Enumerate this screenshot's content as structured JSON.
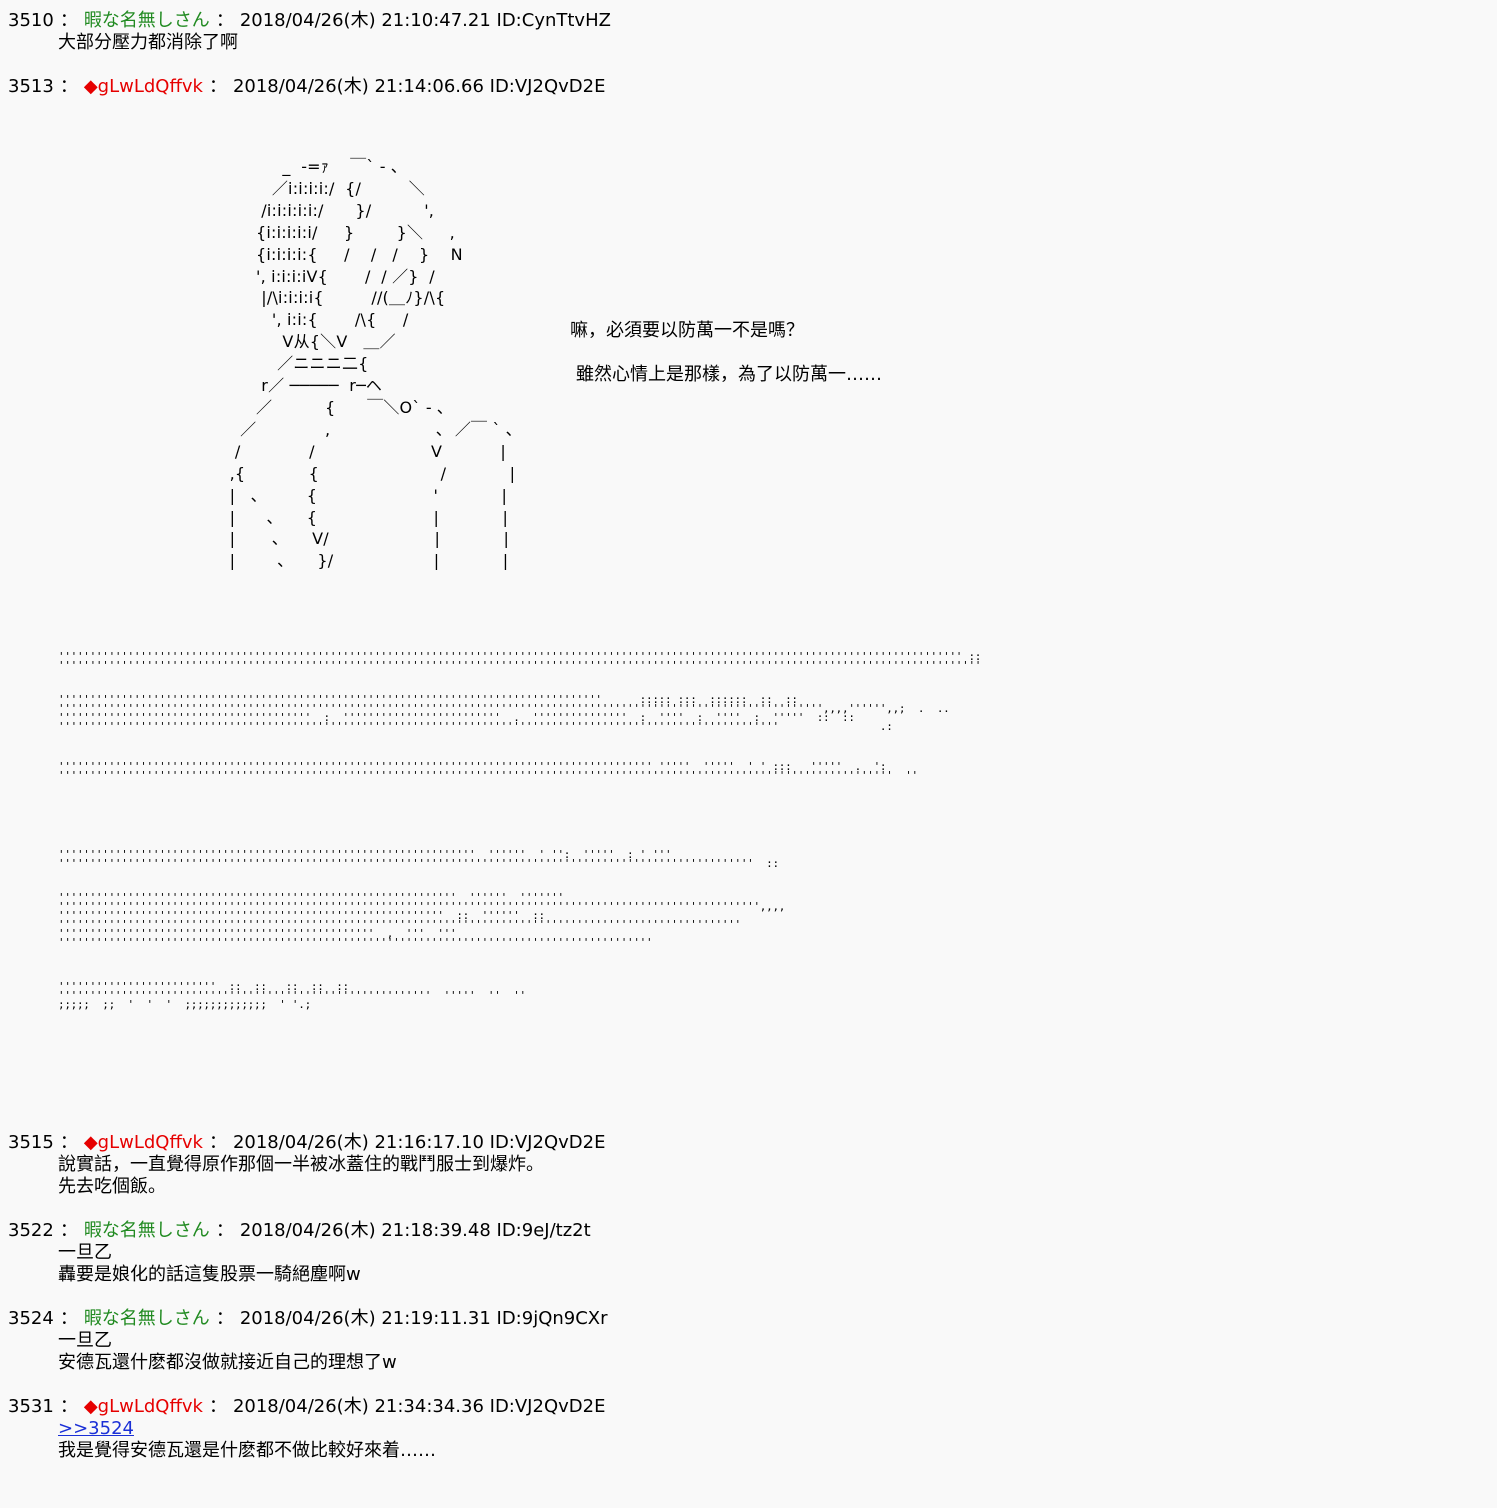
{
  "posts": [
    {
      "num": "3510",
      "name": "暇な名無しさん",
      "date": "2018/04/26(木) 21:10:47.21 ID:CynTtvHZ",
      "lines": [
        "大部分壓力都消除了啊"
      ]
    },
    {
      "num": "3513",
      "name": "◆gLwLdQffvk",
      "date": "2018/04/26(木) 21:14:06.66 ID:VJ2QvD2E"
    },
    {
      "num": "3515",
      "name": "◆gLwLdQffvk",
      "date": "2018/04/26(木) 21:16:17.10 ID:VJ2QvD2E",
      "lines": [
        "說實話，一直覺得原作那個一半被冰蓋住的戰鬥服士到爆炸。",
        "先去吃個飯。"
      ]
    },
    {
      "num": "3522",
      "name": "暇な名無しさん",
      "date": "2018/04/26(木) 21:18:39.48 ID:9eJ/tz2t",
      "lines": [
        "一旦乙",
        "轟要是娘化的話這隻股票一騎絕塵啊w"
      ]
    },
    {
      "num": "3524",
      "name": "暇な名無しさん",
      "date": "2018/04/26(木) 21:19:11.31 ID:9jQn9CXr",
      "lines": [
        "一旦乙",
        "安德瓦還什麽都沒做就接近自己的理想了w"
      ]
    },
    {
      "num": "3531",
      "name": "◆gLwLdQffvk",
      "date": "2018/04/26(木) 21:34:34.36 ID:VJ2QvD2E",
      "anchor": ">>3524",
      "lines": [
        "我是覺得安德瓦還是什麽都不做比較好來着……"
      ]
    }
  ],
  "art": {
    "text": "            _  -=ｧ    ￣` ‐ ､\n          ／i:i:i:i:/  {/         ＼\n        /i:i:i:i:i:/      }/          ',\n       {i:i:i:i:i/     }        }＼     ,\n       {i:i:i:i:{     /    /   /    }    N\n       ', i:i:i:iV{       /  / ／}  /\n        |/\\i:i:i:i{         //(＿ﾉ}/\\{\n          ', i:i:{       /\\{     /\n            V从{＼V   ＿／\n           ／ニニニ二{\n        r／ ─────  r─ヘ\n       ／          {      ￣＼O` ‐ ､\n    ／             ,                    ､  ／￣ ` ､\n   /             /                      V           |\n  ,{            {                       /            |\n  |   ､         {                      '            |\n  |      ､      {                      |            |\n  |       ､      V/                    |            |\n  |        ､      }/                   |            |",
    "dots1": "''''''''''''''''''''''''''''''''''''''''''''''''''''''''''''''''''''''''''''''''''''''''''''''''''''''''''''''''''''''''''''''''''''''''''''''' ::\n''''''''''''''''''''''''''''''''''''''''''''''''''''''''''''''''''''''''''''''''''''''''''''''''''''''''''''''''''''''''''''''''''''''''''''''''''",
    "dots2": "''''''''''''''''''''''''''''''''''''''''''''''''''''''''''''''''''''''''''''''''''''''      ::::: :::  ::::::  ::  ::\n''''''''''''''''''''''''''''''''''''''''''''''''''''''''''''''''''''''''''''''''''''''''''''''''''''''''''''''''''''''''',,,,'''''',,;  .  ..\n''''''''''''''''''''''''''''''''''''''''  :  '''''''''''''''''''''''''  .  '''''''''''''''  :  ''''  :  ''''  :  '''''  ::  ::\n''''''''''''''''''''''''''''''''''''''''''''''''''''''''''''''''''''''''''''''''''''''''''''''''''''''''''''''''''                .:",
    "dots3": "'''''''''''''''''''''''''''''''''''''''''''''''''''''''''''''''''''''''''''''''''''''''''''''' '''''  '''''  ' ' :::   '''''  .  ':\n''''''''''''''''''''''''''''''''''''''''''''''''''''''''''''''''''''''''''''''''''''''''''''''''''''''''''''''''''''''''''''''''''''  ''",
    "dots4": "''''''''''''''''''''''''''''''''''''''''''''''''''''''''''''''''''  ''''''  ' '':  '''''  : ' '''\n''''''''''''''''''''''''''''''''''''''''''''''''''''''''''''''''''''''''''''''''''''''''''''''''''''''''''''''  ::",
    "dots5": "'''''''''''''''''''''''''''''''''''''''''''''''''''''''''''''''  ''''''  '''''''\n''''''''''''''''''''''''''''''''''''''''''''''''''''''''''''''''''''''''''''''''''''''''''''''''''''''''''''''',,,,\n'''''''''''''''''''''''''''''''''''''''''''''''''''''''''''''  ::  ''''''  ::\n''''''''''''''''''''''''''''''''''''''''''''''''''''''''''''''''''''''''''''''''''''''''''''''''''''''''''''\n''''''''''''''''''''''''''''''''''''''''''''''''''  ,  '''  '''\n''''''''''''''''''''''''''''''''''''''''''''''''''''''''''''''''''''''''''''''''''''''''''''''",
    "dots6": "'''''''''''''''''''''''''  ::  ::   ::  ::  ::\n'''''''''''''''''''''''''''''''''''''''''''''''''''''''''''  '''''  ''  ''\n;;;;;  ;;  '  '  '  ;;;;;;;;;;;;;  ' '.;"
  },
  "dialog": {
    "line1": "嘛，必須要以防萬一不是嗎？",
    "line2": "雖然心情上是那樣，為了以防萬一……"
  }
}
